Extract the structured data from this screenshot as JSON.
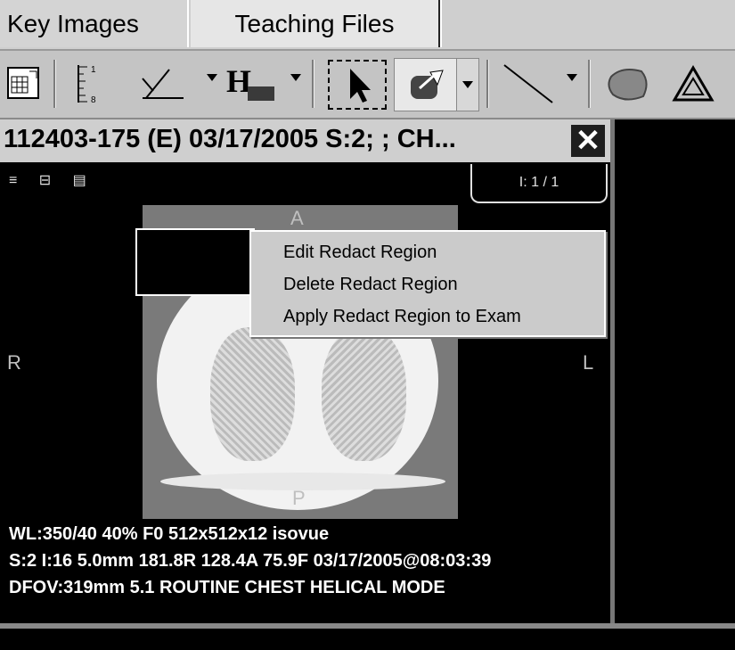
{
  "tabs": [
    {
      "label": "Key Images"
    },
    {
      "label": "Teaching Files"
    }
  ],
  "toolbar": {
    "icons": [
      "grid-layout-icon",
      "ruler-icon",
      "angle-icon",
      "histogram-icon",
      "select-arrow-icon",
      "redact-eraser-icon",
      "line-icon",
      "region-icon",
      "triangle-icon"
    ],
    "ruler_labels": [
      "1",
      "8"
    ]
  },
  "viewer": {
    "title": "112403-175 (E) 03/17/2005 S:2; ; CH...",
    "close_glyph": "✕",
    "image_index": "I: 1 / 1",
    "orientation": {
      "top": "A",
      "bottom": "P",
      "left": "R",
      "right": "L"
    },
    "info_lines": [
      "WL:350/40  40%  F0  512x512x12 isovue",
      "S:2 I:16 5.0mm 181.8R 128.4A 75.9F 03/17/2005@08:03:39",
      "DFOV:319mm  5.1 ROUTINE CHEST      HELICAL MODE"
    ]
  },
  "context_menu": {
    "items": [
      {
        "label": "Edit Redact Region"
      },
      {
        "label": "Delete Redact Region"
      },
      {
        "label": "Apply Redact Region to Exam"
      }
    ]
  }
}
